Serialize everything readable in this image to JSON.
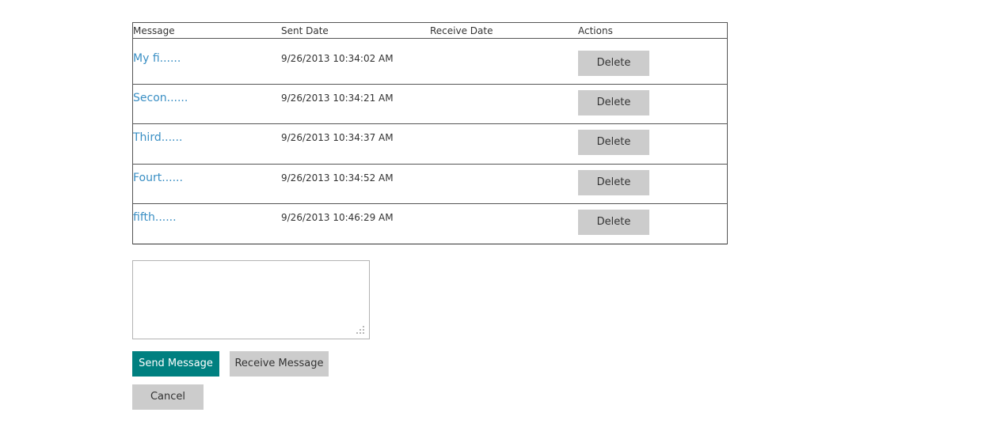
{
  "table": {
    "headers": {
      "message": "Message",
      "sent_date": "Sent Date",
      "receive_date": "Receive Date",
      "actions": "Actions"
    },
    "rows": [
      {
        "message": "My fi......",
        "sent_date": "9/26/2013 10:34:02 AM",
        "receive_date": "",
        "action_label": "Delete"
      },
      {
        "message": "Secon......",
        "sent_date": "9/26/2013 10:34:21 AM",
        "receive_date": "",
        "action_label": "Delete"
      },
      {
        "message": "Third......",
        "sent_date": "9/26/2013 10:34:37 AM",
        "receive_date": "",
        "action_label": "Delete"
      },
      {
        "message": "Fourt......",
        "sent_date": "9/26/2013 10:34:52 AM",
        "receive_date": "",
        "action_label": "Delete"
      },
      {
        "message": "fifth......",
        "sent_date": "9/26/2013 10:46:29 AM",
        "receive_date": "",
        "action_label": "Delete"
      }
    ]
  },
  "composer": {
    "value": "",
    "placeholder": ""
  },
  "buttons": {
    "send_label": "Send Message",
    "receive_label": "Receive Message",
    "cancel_label": "Cancel"
  },
  "colors": {
    "link": "#3a8fc4",
    "primary_button": "#008080",
    "secondary_button": "#cccccc",
    "border": "#555555"
  },
  "icons": {
    "textarea_resize": "resize-grip-icon"
  }
}
